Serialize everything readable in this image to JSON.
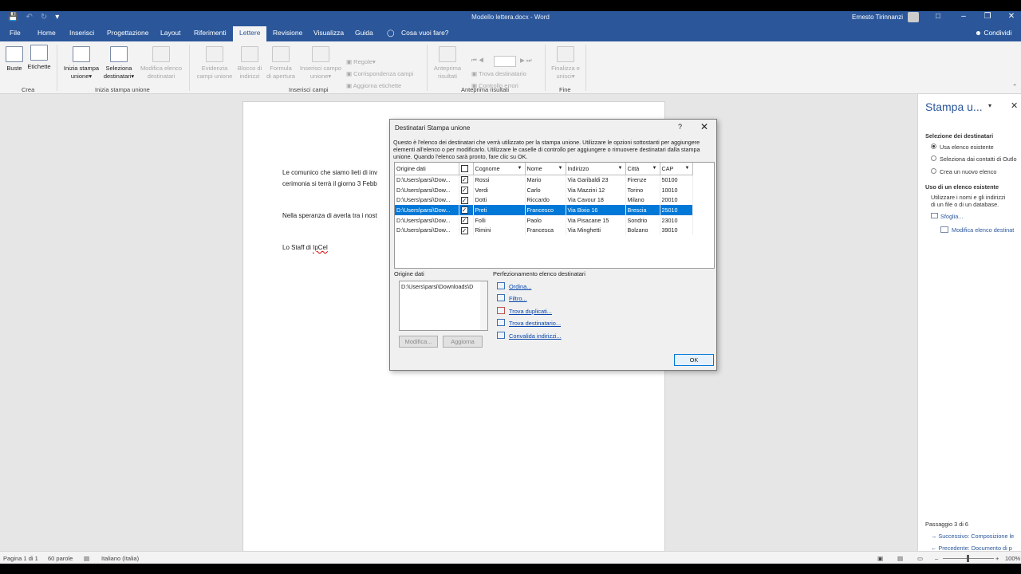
{
  "window": {
    "title": "Modello lettera.docx - Word",
    "user": "Ernesto Tirinnanzi"
  },
  "tabs": [
    "File",
    "Home",
    "Inserisci",
    "Progettazione",
    "Layout",
    "Riferimenti",
    "Lettere",
    "Revisione",
    "Visualizza",
    "Guida"
  ],
  "tell_me": "Cosa vuoi fare?",
  "share": "Condividi",
  "ribbon": {
    "buste": "Buste",
    "etichette": "Etichette",
    "group_crea": "Crea",
    "inizia_l1": "Inizia stampa",
    "inizia_l2": "unione",
    "seleziona_l1": "Seleziona",
    "seleziona_l2": "destinatari",
    "modifica_l1": "Modifica elenco",
    "modifica_l2": "destinatari",
    "group_inizia": "Inizia stampa unione",
    "evidenzia_l1": "Evidenzia",
    "evidenzia_l2": "campi unione",
    "blocco_l1": "Blocco di",
    "blocco_l2": "indirizzi",
    "formula_l1": "Formula",
    "formula_l2": "di apertura",
    "inserisci_l1": "Inserisci campo",
    "inserisci_l2": "unione",
    "regole": "Regole",
    "corrispondenza": "Corrispondenza campi",
    "aggiorna": "Aggiorna etichette",
    "group_inserisci": "Inserisci campi",
    "anteprima_l1": "Anteprima",
    "anteprima_l2": "risultati",
    "trova_dest": "Trova destinatario",
    "controllo": "Controllo errori",
    "group_anteprima": "Anteprima risultati",
    "finalizza_l1": "Finalizza e",
    "finalizza_l2": "unisci",
    "group_fine": "Fine"
  },
  "document": {
    "line1": "Le comunico che siamo lieti di inv",
    "line2": "cerimonia si terrà il giorno 3 Febb",
    "line3": "Nella speranza di averla tra i nost",
    "sign_prefix": "Lo Staff di ",
    "sign_name": "IpCel"
  },
  "dialog": {
    "title": "Destinatari Stampa unione",
    "help": "?",
    "description": "Questo è l'elenco dei destinatari che verrà utilizzato per la stampa unione. Utilizzare le opzioni sottostanti per aggiungere elementi all'elenco o per modificarlo. Utilizzare le caselle di controllo per aggiungere o rimuovere destinatari dalla stampa unione. Quando l'elenco sarà pronto, fare clic su OK.",
    "columns": [
      "Origine dati",
      "",
      "Cognome",
      "Nome",
      "Indirizzo",
      "Città",
      "CAP"
    ],
    "rows": [
      {
        "source": "D:\\Users\\parsi\\Dow...",
        "cognome": "Rossi",
        "nome": "Mario",
        "indirizzo": "Via Garibaldi 23",
        "citta": "Firenze",
        "cap": "50100"
      },
      {
        "source": "D:\\Users\\parsi\\Dow...",
        "cognome": "Verdi",
        "nome": "Carlo",
        "indirizzo": "Via Mazzini 12",
        "citta": "Torino",
        "cap": "10010"
      },
      {
        "source": "D:\\Users\\parsi\\Dow...",
        "cognome": "Dotti",
        "nome": "Riccardo",
        "indirizzo": "Via Cavour 18",
        "citta": "Milano",
        "cap": "20010"
      },
      {
        "source": "D:\\Users\\parsi\\Dow...",
        "cognome": "Preti",
        "nome": "Francesco",
        "indirizzo": "Via Bixio 16",
        "citta": "Brescia",
        "cap": "25010"
      },
      {
        "source": "D:\\Users\\parsi\\Dow...",
        "cognome": "Folli",
        "nome": "Paolo",
        "indirizzo": "Via Pisacane 15",
        "citta": "Sondrio",
        "cap": "23010"
      },
      {
        "source": "D:\\Users\\parsi\\Dow...",
        "cognome": "Rimini",
        "nome": "Francesca",
        "indirizzo": "Via Minghetti",
        "citta": "Bolzano",
        "cap": "39010"
      }
    ],
    "selected_row_index": 3,
    "origine_label": "Origine dati",
    "origine_value": "D:\\Users\\parsi\\Downloads\\D",
    "modifica_btn": "Modifica...",
    "aggiorna_btn": "Aggiorna",
    "perfez_label": "Perfezionamento elenco destinatari",
    "links": [
      "Ordina...",
      "Filtro...",
      "Trova duplicati...",
      "Trova destinatario...",
      "Convalida indirizzi..."
    ],
    "ok": "OK"
  },
  "pane": {
    "title": "Stampa u...",
    "sel_heading": "Selezione dei destinatari",
    "opt1": "Usa elenco esistente",
    "opt2": "Seleziona dai contatti di Outlo",
    "opt3": "Crea un nuovo elenco",
    "uso_heading": "Uso di un elenco esistente",
    "uso_l1": "Utilizzare i nomi e gli indirizzi",
    "uso_l2": "di un file o di un database.",
    "sfoglia": "Sfoglia...",
    "modifica": "Modifica elenco destinat",
    "step": "Passaggio 3 di 6",
    "next": "Successivo: Composizione le",
    "prev": "Precedente: Documento di p"
  },
  "statusbar": {
    "page": "Pagina 1 di 1",
    "words": "60 parole",
    "lang": "Italiano (Italia)",
    "zoom": "100%"
  }
}
